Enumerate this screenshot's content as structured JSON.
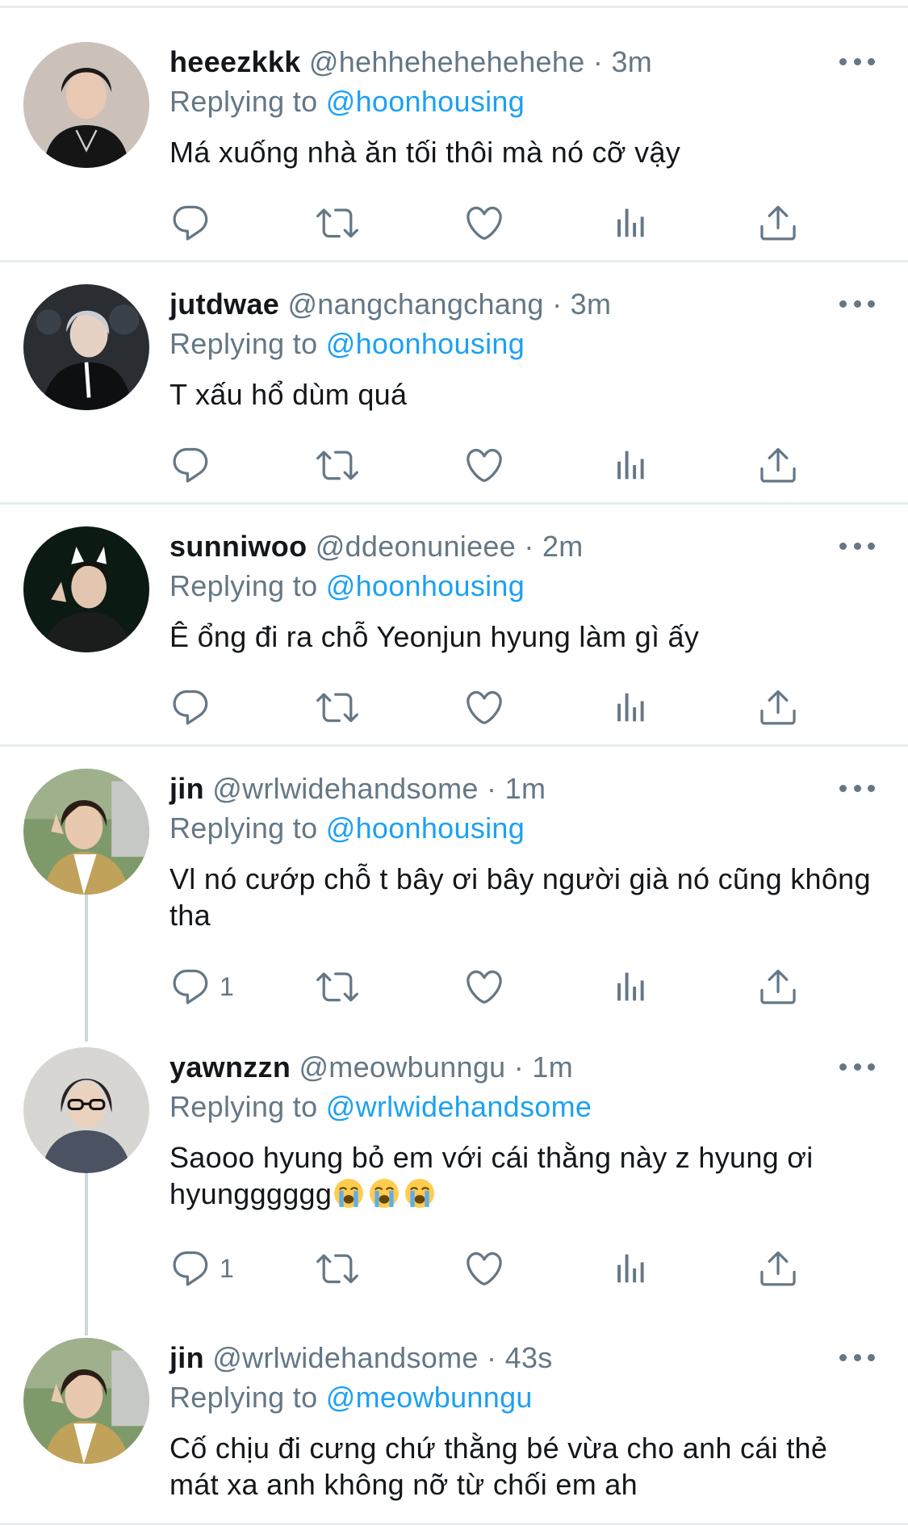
{
  "tweets": [
    {
      "name": "heeezkkk",
      "handle": "@hehhehehehehehe",
      "time": "3m",
      "replying_prefix": "Replying to",
      "replying_to": "@hoonhousing",
      "text": "Má xuống nhà ăn tối thôi mà nó cỡ vậy",
      "reply_count": ""
    },
    {
      "name": "jutdwae",
      "handle": "@nangchangchang",
      "time": "3m",
      "replying_prefix": "Replying to",
      "replying_to": "@hoonhousing",
      "text": "T xấu hổ dùm quá",
      "reply_count": ""
    },
    {
      "name": "sunniwoo",
      "handle": "@ddeonunieee",
      "time": "2m",
      "replying_prefix": "Replying to",
      "replying_to": "@hoonhousing",
      "text": "Ê ổng đi ra chỗ Yeonjun hyung làm gì ấy",
      "reply_count": ""
    },
    {
      "name": "jin",
      "handle": "@wrlwidehandsome",
      "time": "1m",
      "replying_prefix": "Replying to",
      "replying_to": "@hoonhousing",
      "text": "Vl nó cướp chỗ t bây ơi bây người già nó cũng không tha",
      "reply_count": "1"
    },
    {
      "name": "yawnzzn",
      "handle": "@meowbunngu",
      "time": "1m",
      "replying_prefix": "Replying to",
      "replying_to": "@wrlwidehandsome",
      "text": "Saooo hyung bỏ em với cái thằng này z hyung ơi hyungggggg",
      "emoji_count_label": "😭😭😭",
      "reply_count": "1"
    },
    {
      "name": "jin",
      "handle": "@wrlwidehandsome",
      "time": "43s",
      "replying_prefix": "Replying to",
      "replying_to": "@meowbunngu",
      "text": "Cố chịu đi cưng chứ thằng bé vừa cho anh cái thẻ mát xa anh không nỡ từ chối em ah",
      "reply_count": ""
    }
  ],
  "separator": "·",
  "icons": [
    "reply-icon",
    "retweet-icon",
    "like-icon",
    "analytics-icon",
    "share-icon",
    "more-icon",
    "crying-face-emoji"
  ],
  "colors": {
    "text": "#14171a",
    "secondary": "#657786",
    "link": "#1da1f2",
    "divider": "#e6ecf0",
    "thread": "#ccd6dd"
  }
}
